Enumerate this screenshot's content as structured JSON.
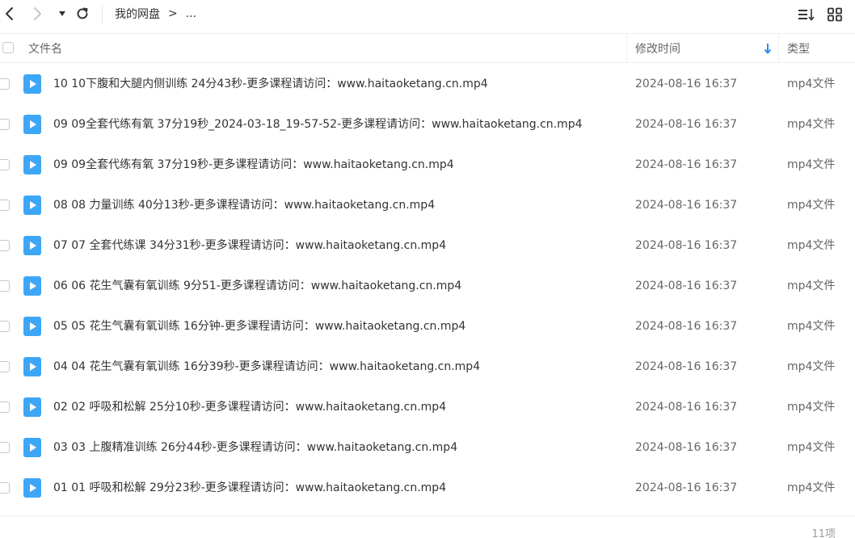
{
  "breadcrumb": {
    "root": "我的网盘",
    "separator": ">",
    "more": "..."
  },
  "columns": {
    "name": "文件名",
    "modified": "修改时间",
    "type": "类型"
  },
  "colors": {
    "accent": "#2d8cf0",
    "file_icon": "#3ea6f6"
  },
  "files": [
    {
      "name": "10 10下腹和大腿内侧训练 24分43秒-更多课程请访问：www.haitaoketang.cn.mp4",
      "modified": "2024-08-16 16:37",
      "type": "mp4文件"
    },
    {
      "name": "09 09全套代练有氧  37分19秒_2024-03-18_19-57-52-更多课程请访问：www.haitaoketang.cn.mp4",
      "modified": "2024-08-16 16:37",
      "type": "mp4文件"
    },
    {
      "name": "09 09全套代练有氧  37分19秒-更多课程请访问：www.haitaoketang.cn.mp4",
      "modified": "2024-08-16 16:37",
      "type": "mp4文件"
    },
    {
      "name": "08 08 力量训练 40分13秒-更多课程请访问：www.haitaoketang.cn.mp4",
      "modified": "2024-08-16 16:37",
      "type": "mp4文件"
    },
    {
      "name": "07 07 全套代练课  34分31秒-更多课程请访问：www.haitaoketang.cn.mp4",
      "modified": "2024-08-16 16:37",
      "type": "mp4文件"
    },
    {
      "name": "06 06 花生气囊有氧训练  9分51-更多课程请访问：www.haitaoketang.cn.mp4",
      "modified": "2024-08-16 16:37",
      "type": "mp4文件"
    },
    {
      "name": "05 05 花生气囊有氧训练 16分钟-更多课程请访问：www.haitaoketang.cn.mp4",
      "modified": "2024-08-16 16:37",
      "type": "mp4文件"
    },
    {
      "name": "04 04 花生气囊有氧训练 16分39秒-更多课程请访问：www.haitaoketang.cn.mp4",
      "modified": "2024-08-16 16:37",
      "type": "mp4文件"
    },
    {
      "name": "02 02 呼吸和松解 25分10秒-更多课程请访问：www.haitaoketang.cn.mp4",
      "modified": "2024-08-16 16:37",
      "type": "mp4文件"
    },
    {
      "name": "03 03 上腹精准训练 26分44秒-更多课程请访问：www.haitaoketang.cn.mp4",
      "modified": "2024-08-16 16:37",
      "type": "mp4文件"
    },
    {
      "name": "01 01 呼吸和松解 29分23秒-更多课程请访问：www.haitaoketang.cn.mp4",
      "modified": "2024-08-16 16:37",
      "type": "mp4文件"
    }
  ],
  "footer": {
    "count": "11项"
  }
}
